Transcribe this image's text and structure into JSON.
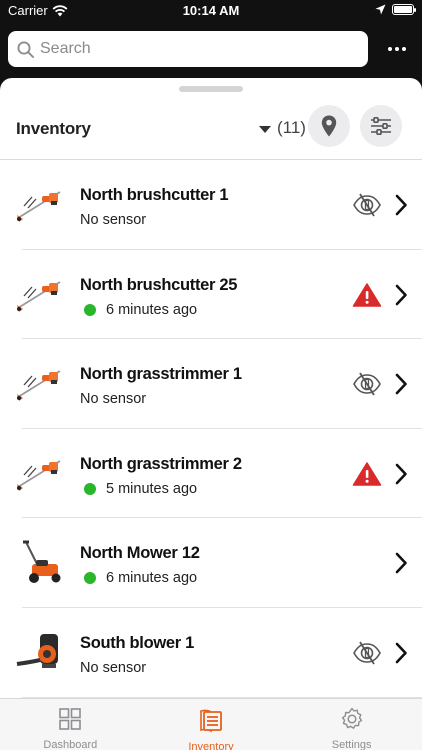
{
  "status_bar": {
    "carrier": "Carrier",
    "time": "10:14 AM"
  },
  "search": {
    "placeholder": "Search"
  },
  "inventory": {
    "title": "Inventory",
    "count": "(11)"
  },
  "items": [
    {
      "name": "North brushcutter 1",
      "status_text": "No sensor",
      "online": false,
      "status_icon": "no-sensor-icon",
      "thumb": "brushcutter"
    },
    {
      "name": "North brushcutter 25",
      "status_text": "6 minutes ago",
      "online": true,
      "status_icon": "warning-icon",
      "thumb": "brushcutter"
    },
    {
      "name": "North grasstrimmer 1",
      "status_text": "No sensor",
      "online": false,
      "status_icon": "no-sensor-icon",
      "thumb": "brushcutter"
    },
    {
      "name": "North grasstrimmer 2",
      "status_text": "5 minutes ago",
      "online": true,
      "status_icon": "warning-icon",
      "thumb": "brushcutter"
    },
    {
      "name": "North Mower 12",
      "status_text": "6 minutes ago",
      "online": true,
      "status_icon": "",
      "thumb": "mower"
    },
    {
      "name": "South blower 1",
      "status_text": "No sensor",
      "online": false,
      "status_icon": "no-sensor-icon",
      "thumb": "blower"
    }
  ],
  "tabs": [
    {
      "label": "Dashboard",
      "icon": "dashboard-icon",
      "active": false
    },
    {
      "label": "Inventory",
      "icon": "inventory-icon",
      "active": true
    },
    {
      "label": "Settings",
      "icon": "settings-gear-icon",
      "active": false
    }
  ],
  "colors": {
    "accent": "#e8601c",
    "online": "#2bb52b",
    "warning": "#d92b2b"
  }
}
